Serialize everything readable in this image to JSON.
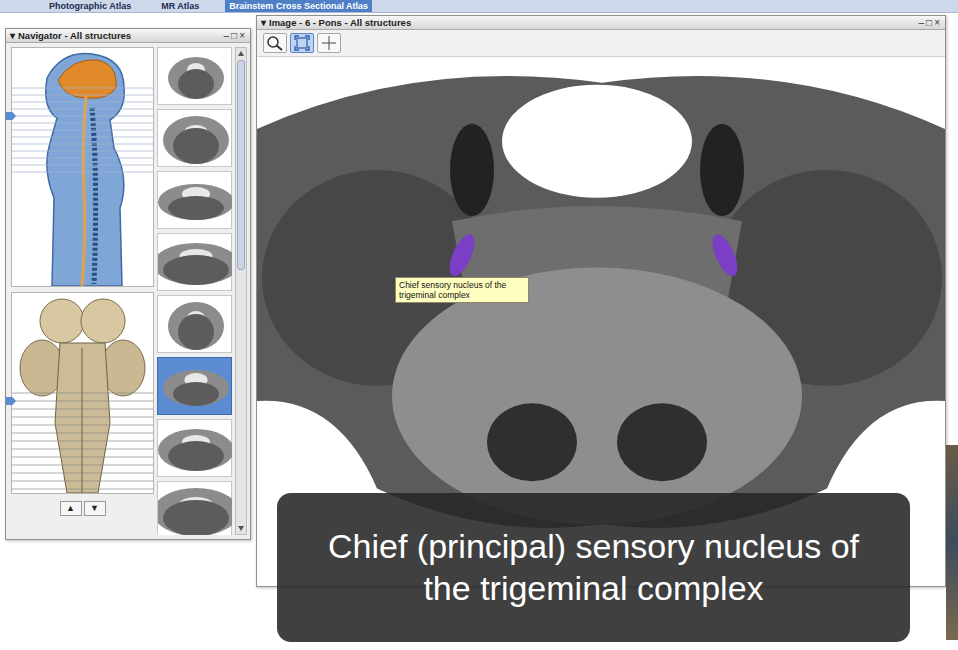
{
  "app_tabs": [
    {
      "label": "Photographic Atlas",
      "selected": false
    },
    {
      "label": "MR Atlas",
      "selected": false
    },
    {
      "label": "Brainstem Cross Sectional Atlas",
      "selected": true
    }
  ],
  "navigator": {
    "collapse": "▾",
    "title": "Navigator - All structures",
    "controls": [
      "–",
      "□",
      "×"
    ],
    "thumbnails": [
      {
        "selected": false
      },
      {
        "selected": false
      },
      {
        "selected": false
      },
      {
        "selected": false
      },
      {
        "selected": false
      },
      {
        "selected": true
      },
      {
        "selected": false
      },
      {
        "selected": false
      }
    ],
    "buttons": [
      "▲",
      "▼"
    ]
  },
  "image_window": {
    "collapse": "▾",
    "title": "Image - 6 - Pons - All structures",
    "controls": [
      "–",
      "□",
      "×"
    ],
    "toolbar": [
      {
        "kind": "zoom",
        "selected": false
      },
      {
        "kind": "fit",
        "selected": true
      },
      {
        "kind": "crosshair",
        "selected": false
      }
    ],
    "tooltip": "Chief sensory nucleus of the trigeminal complex"
  },
  "caption": "Chief (principal) sensory nucleus of the trigeminal complex"
}
